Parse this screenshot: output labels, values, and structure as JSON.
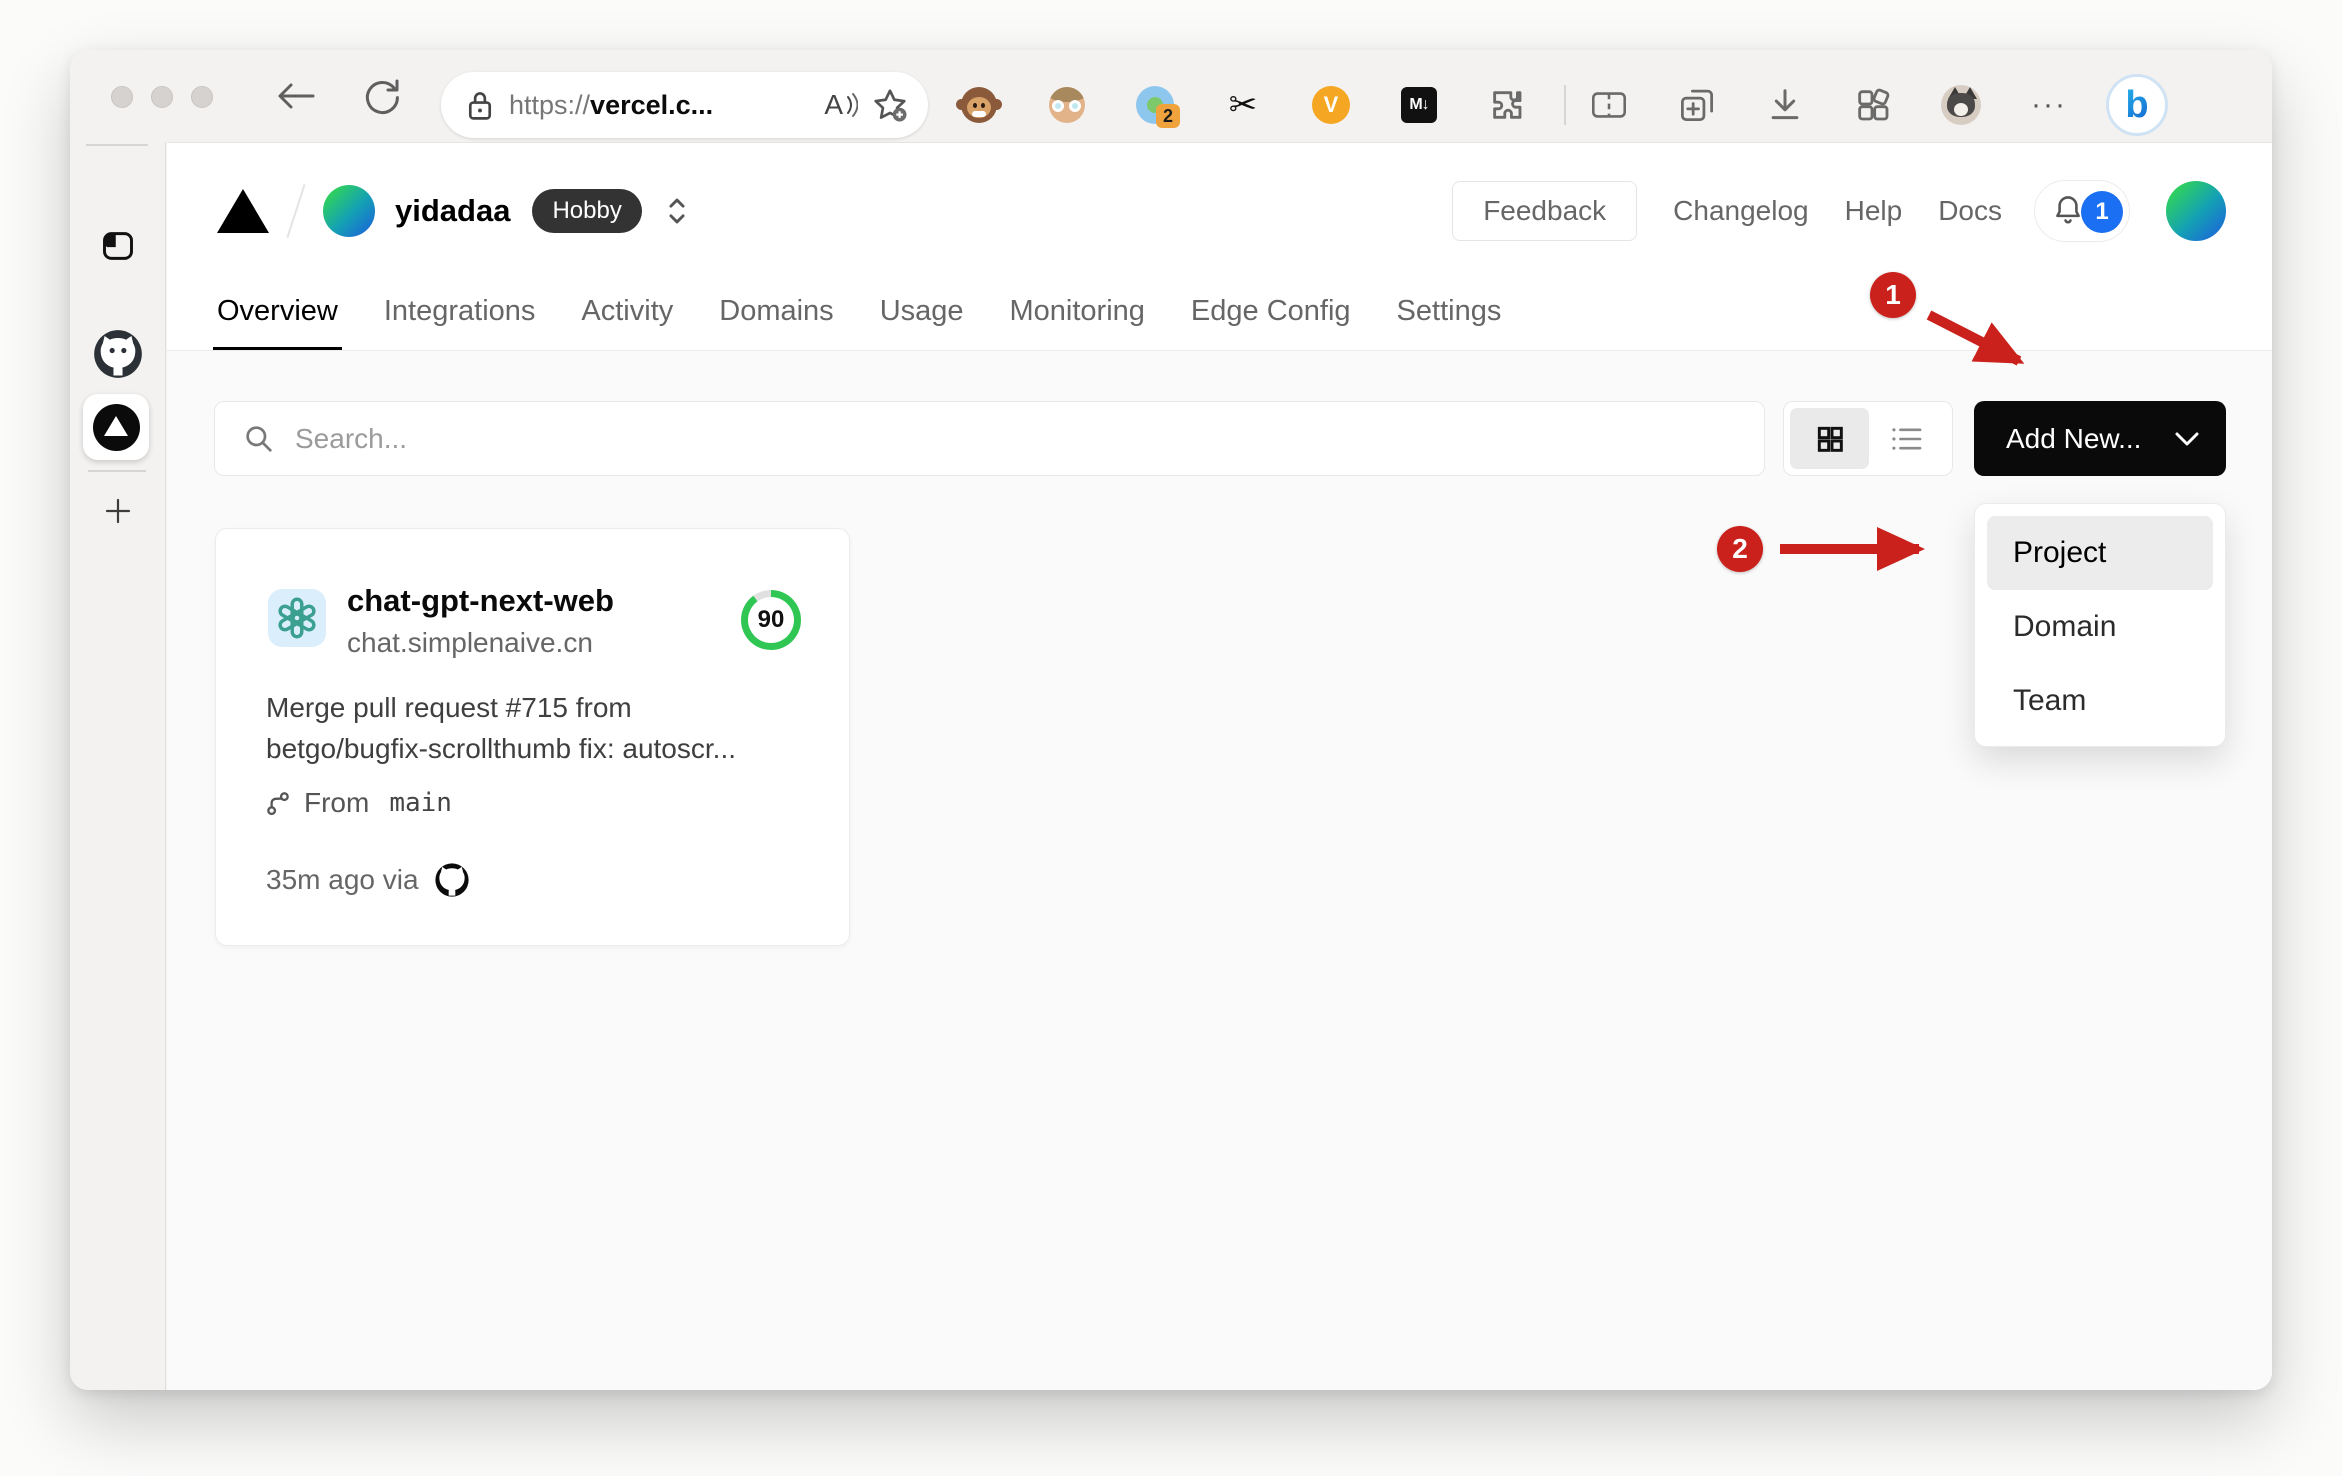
{
  "browser": {
    "url": {
      "scheme": "https://",
      "host": "vercel.c..."
    },
    "read_aloud_label": "A",
    "ext_translate_badge": "2",
    "scissors_glyph": "✂",
    "ext_v_label": "V",
    "ext_markdown_label": "M↓",
    "more_glyph": "···",
    "bing_label": "b"
  },
  "vercel_header": {
    "team_name": "yidadaa",
    "plan_badge": "Hobby",
    "feedback_label": "Feedback",
    "links": [
      {
        "label": "Changelog"
      },
      {
        "label": "Help"
      },
      {
        "label": "Docs"
      }
    ],
    "notification_count": "1"
  },
  "tabs": [
    {
      "label": "Overview",
      "active": true
    },
    {
      "label": "Integrations",
      "active": false
    },
    {
      "label": "Activity",
      "active": false
    },
    {
      "label": "Domains",
      "active": false
    },
    {
      "label": "Usage",
      "active": false
    },
    {
      "label": "Monitoring",
      "active": false
    },
    {
      "label": "Edge Config",
      "active": false
    },
    {
      "label": "Settings",
      "active": false
    }
  ],
  "controls": {
    "search_placeholder": "Search...",
    "add_new_label": "Add New..."
  },
  "project_card": {
    "name": "chat-gpt-next-web",
    "domain": "chat.simplenaive.cn",
    "score": "90",
    "commit_lines": [
      "Merge pull request #715 from",
      "betgo/bugfix-scrollthumb fix: autoscr..."
    ],
    "branch_from_label": "From",
    "branch_name": "main",
    "deploy_meta": "35m ago via"
  },
  "dropdown": {
    "items": [
      {
        "label": "Project",
        "highlighted": true
      },
      {
        "label": "Domain",
        "highlighted": false
      },
      {
        "label": "Team",
        "highlighted": false
      }
    ]
  },
  "annotations": {
    "step1": "1",
    "step2": "2"
  },
  "colors": {
    "accent_red": "#cb211c",
    "score_green": "#2fc654",
    "badge_blue": "#1a6ff2",
    "add_new_bg": "#0a0a0a",
    "page_body_bg": "#fafafa"
  }
}
